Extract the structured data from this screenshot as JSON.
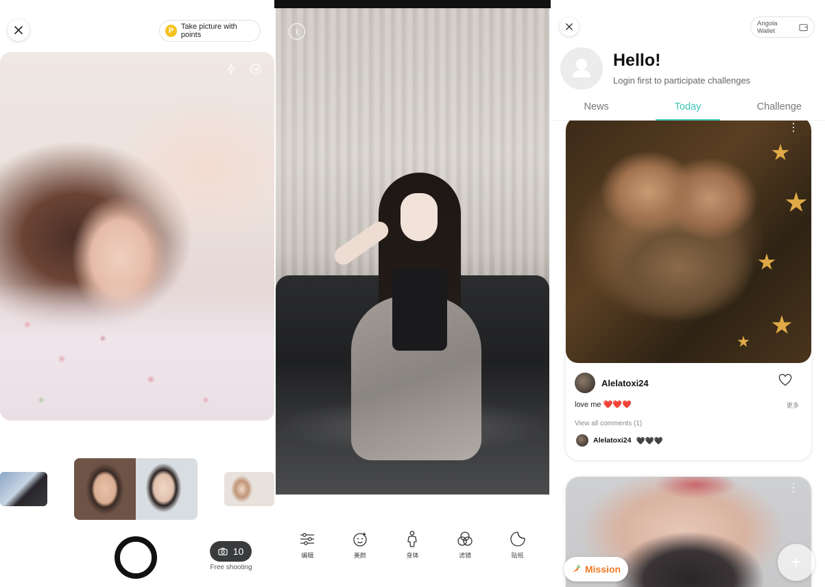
{
  "camera_screen": {
    "close_icon": "close-icon",
    "points_button": {
      "coin_letter": "P",
      "label": "Take picture with points"
    },
    "top_icons": [
      "flash-icon",
      "switch-camera-icon"
    ],
    "filter_thumbnails": [
      "style-left",
      "style-selected",
      "style-right"
    ],
    "shots_counter": {
      "value": "10",
      "label": "Free shooting"
    }
  },
  "editor_screen": {
    "info_icon": "info-icon",
    "tools": [
      {
        "icon": "adjust-icon",
        "label": "编辑"
      },
      {
        "icon": "beauty-face-icon",
        "label": "美颜"
      },
      {
        "icon": "body-icon",
        "label": "身体"
      },
      {
        "icon": "filter-icon",
        "label": "滤镜"
      },
      {
        "icon": "sticker-icon",
        "label": "贴纸"
      }
    ]
  },
  "social_screen": {
    "wallet_label": "Angola Wallet",
    "greeting": "Hello!",
    "greeting_sub": "Login first to participate challenges",
    "tabs": [
      "News",
      "Today",
      "Challenge"
    ],
    "active_tab": "Today",
    "accent_color": "#3cc6b5",
    "post": {
      "username": "Alelatoxi24",
      "caption": "love me ❤️❤️❤️",
      "more_label": "更多",
      "view_comments": "View all comments (1)",
      "comment": {
        "username": "Alelatoxi24",
        "text": "🖤🖤🖤"
      }
    },
    "mission_label": "Mission",
    "mission_color": "#f07a25",
    "fab_label": "+"
  }
}
